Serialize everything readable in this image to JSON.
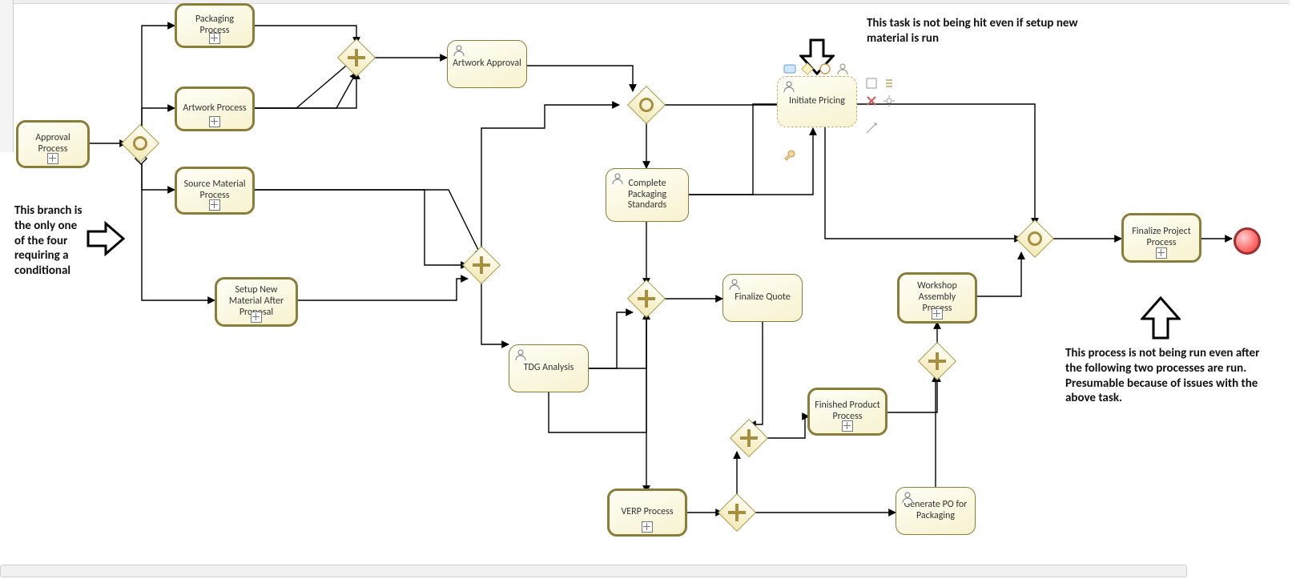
{
  "nodes": {
    "approval_process": "Approval Process",
    "packaging_process": "Packaging Process",
    "artwork_process": "Artwork Process",
    "source_material_process": "Source Material Process",
    "setup_new_material": "Setup New Material After Proposal",
    "artwork_approval": "Artwork Approval",
    "tdg_analysis": "TDG Analysis",
    "complete_packaging_standards": "Complete Packaging Standards",
    "initiate_pricing": "Initiate Pricing",
    "finalize_quote": "Finalize Quote",
    "finished_product_process": "Finished Product Process",
    "verp_process": "VERP Process",
    "generate_po": "Generate PO for Packaging",
    "workshop_assembly_process": "Workshop Assembly Process",
    "finalize_project_process": "Finalize Project Process"
  },
  "annotations": {
    "left": "This branch is the only one of the four requiring a conditional",
    "top_right": "This task is not being hit even if setup new material is run",
    "bottom_right": "This process is not being run even after the following two processes are run. Presumable because of issues with the above task."
  },
  "flows": [
    {
      "from": "approval_process",
      "to": "gw_inclusive_1"
    },
    {
      "from": "gw_inclusive_1",
      "to": "packaging_process"
    },
    {
      "from": "gw_inclusive_1",
      "to": "artwork_process"
    },
    {
      "from": "gw_inclusive_1",
      "to": "source_material_process"
    },
    {
      "from": "gw_inclusive_1",
      "to": "setup_new_material"
    },
    {
      "from": "packaging_process",
      "to": "gw_parallel_a"
    },
    {
      "from": "artwork_process",
      "to": "gw_parallel_a"
    },
    {
      "from": "gw_parallel_a",
      "to": "artwork_approval"
    },
    {
      "from": "artwork_approval",
      "to": "gw_inclusive_2"
    },
    {
      "from": "source_material_process",
      "to": "gw_parallel_b"
    },
    {
      "from": "setup_new_material",
      "to": "gw_parallel_b"
    },
    {
      "from": "gw_parallel_b",
      "to": "tdg_analysis"
    },
    {
      "from": "gw_parallel_b",
      "to": "gw_inclusive_2"
    },
    {
      "from": "gw_inclusive_2",
      "to": "complete_packaging_standards"
    },
    {
      "from": "gw_inclusive_2",
      "to": "gw_inclusive_4"
    },
    {
      "from": "tdg_analysis",
      "to": "gw_parallel_c"
    },
    {
      "from": "complete_packaging_standards",
      "to": "gw_parallel_c"
    },
    {
      "from": "complete_packaging_standards",
      "to": "initiate_pricing"
    },
    {
      "from": "gw_parallel_c",
      "to": "finalize_quote"
    },
    {
      "from": "gw_parallel_c",
      "to": "verp_process"
    },
    {
      "from": "finalize_quote",
      "to": "gw_parallel_d"
    },
    {
      "from": "gw_parallel_d",
      "to": "finished_product_process"
    },
    {
      "from": "verp_process",
      "to": "gw_parallel_e"
    },
    {
      "from": "gw_parallel_e",
      "to": "generate_po"
    },
    {
      "from": "gw_parallel_e",
      "to": "gw_parallel_d"
    },
    {
      "from": "finished_product_process",
      "to": "gw_parallel_f"
    },
    {
      "from": "generate_po",
      "to": "gw_parallel_f"
    },
    {
      "from": "gw_parallel_f",
      "to": "workshop_assembly_process"
    },
    {
      "from": "workshop_assembly_process",
      "to": "gw_inclusive_4"
    },
    {
      "from": "initiate_pricing",
      "to": "gw_inclusive_4"
    },
    {
      "from": "gw_inclusive_4",
      "to": "finalize_project_process"
    },
    {
      "from": "finalize_project_process",
      "to": "end_event"
    }
  ],
  "chart_data": {
    "type": "bpmn-diagram",
    "start": "approval_process",
    "end": "end_event",
    "gateways": [
      {
        "id": "gw_inclusive_1",
        "type": "inclusive"
      },
      {
        "id": "gw_parallel_a",
        "type": "parallel"
      },
      {
        "id": "gw_parallel_b",
        "type": "parallel"
      },
      {
        "id": "gw_inclusive_2",
        "type": "inclusive"
      },
      {
        "id": "gw_parallel_c",
        "type": "parallel"
      },
      {
        "id": "gw_parallel_d",
        "type": "parallel"
      },
      {
        "id": "gw_parallel_e",
        "type": "parallel"
      },
      {
        "id": "gw_parallel_f",
        "type": "parallel"
      },
      {
        "id": "gw_inclusive_4",
        "type": "inclusive"
      }
    ],
    "tasks": [
      {
        "id": "approval_process",
        "type": "subprocess"
      },
      {
        "id": "packaging_process",
        "type": "subprocess"
      },
      {
        "id": "artwork_process",
        "type": "subprocess"
      },
      {
        "id": "source_material_process",
        "type": "subprocess"
      },
      {
        "id": "setup_new_material",
        "type": "subprocess"
      },
      {
        "id": "artwork_approval",
        "type": "user-task"
      },
      {
        "id": "tdg_analysis",
        "type": "user-task"
      },
      {
        "id": "complete_packaging_standards",
        "type": "user-task"
      },
      {
        "id": "initiate_pricing",
        "type": "user-task",
        "selected": true
      },
      {
        "id": "finalize_quote",
        "type": "user-task"
      },
      {
        "id": "finished_product_process",
        "type": "subprocess"
      },
      {
        "id": "verp_process",
        "type": "subprocess"
      },
      {
        "id": "generate_po",
        "type": "user-task"
      },
      {
        "id": "workshop_assembly_process",
        "type": "subprocess"
      },
      {
        "id": "finalize_project_process",
        "type": "subprocess"
      }
    ]
  }
}
